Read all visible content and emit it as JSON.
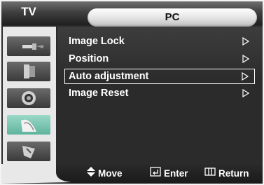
{
  "header": {
    "source_label": "TV",
    "menu_title": "PC"
  },
  "sidebar": {
    "items": [
      {
        "icon": "input-icon",
        "active": false
      },
      {
        "icon": "picture-icon",
        "active": false
      },
      {
        "icon": "sound-icon",
        "active": false
      },
      {
        "icon": "setup-icon",
        "active": true
      },
      {
        "icon": "pc-icon",
        "active": false
      }
    ]
  },
  "menu": {
    "items": [
      {
        "label": "Image Lock",
        "selected": false
      },
      {
        "label": "Position",
        "selected": false
      },
      {
        "label": "Auto adjustment",
        "selected": true
      },
      {
        "label": "Image Reset",
        "selected": false
      }
    ]
  },
  "footer": {
    "move_label": "Move",
    "enter_label": "Enter",
    "return_label": "Return"
  },
  "colors": {
    "accent": "#6fc2ad",
    "header_dark": "#1f1f1f",
    "sidebar_bg": "#e8e8e8"
  }
}
